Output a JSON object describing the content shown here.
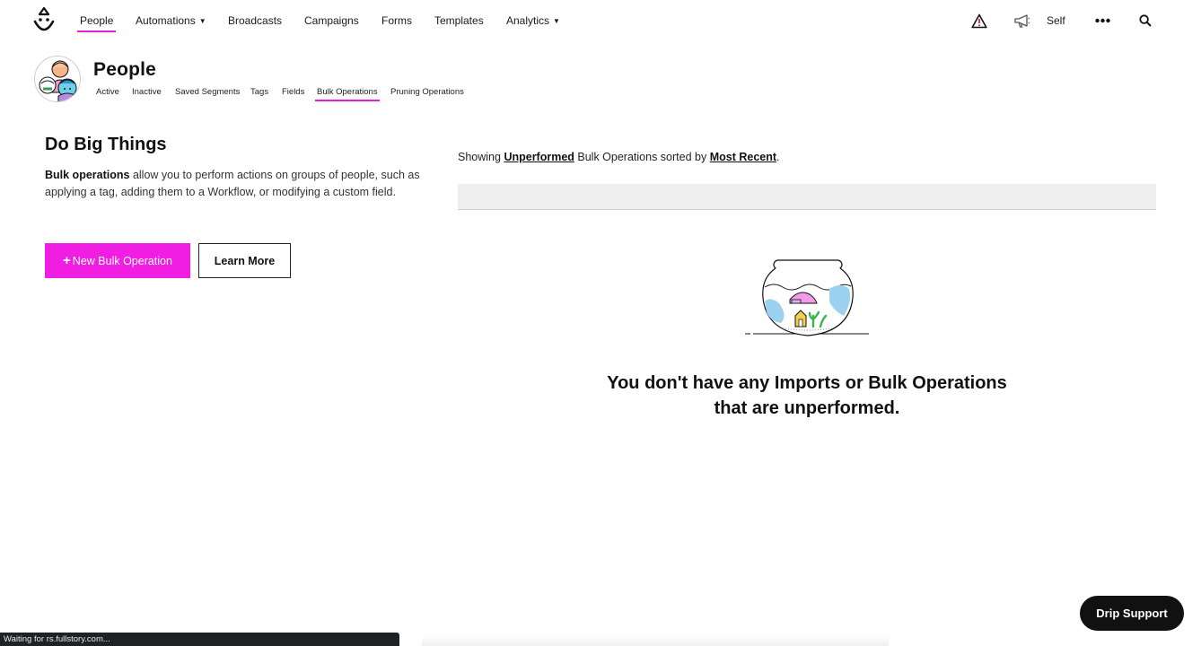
{
  "nav": {
    "items": [
      {
        "label": "People",
        "active": true
      },
      {
        "label": "Automations",
        "dropdown": true
      },
      {
        "label": "Broadcasts"
      },
      {
        "label": "Campaigns"
      },
      {
        "label": "Forms"
      },
      {
        "label": "Templates"
      },
      {
        "label": "Analytics",
        "dropdown": true
      }
    ],
    "account_label": "Self",
    "icons": [
      "logo-icon",
      "alert-icon",
      "megaphone-icon",
      "more-icon",
      "search-icon"
    ]
  },
  "page": {
    "title": "People",
    "subtabs": [
      {
        "label": "Active"
      },
      {
        "label": "Inactive"
      },
      {
        "label": "Saved Segments"
      },
      {
        "label": "Tags"
      },
      {
        "label": "Fields"
      },
      {
        "label": "Bulk Operations",
        "active": true
      },
      {
        "label": "Pruning Operations"
      }
    ]
  },
  "intro": {
    "title": "Do Big Things",
    "desc_bold": "Bulk operations",
    "desc_rest": " allow you to perform actions on groups of people, such as applying a tag, adding them to a Workflow, or modifying a custom field.",
    "new_button": "New Bulk Operation",
    "learn_button": "Learn More"
  },
  "list": {
    "prefix": "Showing ",
    "filter": "Unperformed",
    "middle": " Bulk Operations sorted by ",
    "sort": "Most Recent",
    "suffix": ".",
    "empty_line1": "You don't have any Imports or Bulk Operations",
    "empty_line2": "that are unperformed."
  },
  "status_text": "Waiting for rs.fullstory.com...",
  "support_label": "Drip Support",
  "colors": {
    "accent": "#f01ee2",
    "underline": "#e61fd6",
    "dark": "#111111"
  }
}
